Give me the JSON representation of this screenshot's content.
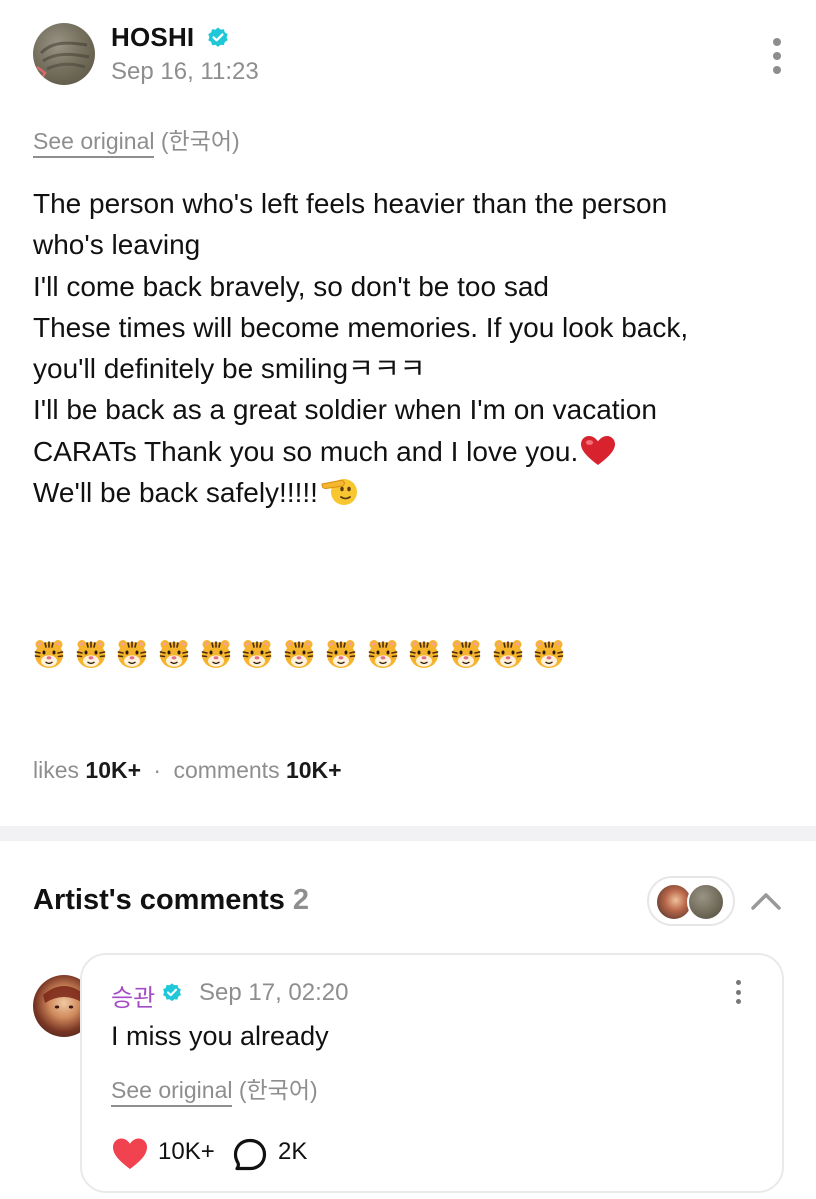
{
  "post": {
    "author": "HOSHI",
    "verified_icon": "verified-check-icon",
    "timestamp": "Sep 16, 11:23",
    "see_original_label": "See original",
    "original_language": "(한국어)",
    "body_lines": [
      "The person who's left feels heavier than the person",
      "who's leaving",
      "I'll come back bravely, so don't be too sad",
      "These times will become memories. If you look back,",
      "you'll definitely be smilingㅋㅋㅋ",
      "I'll be back as a great soldier when I'm on vacation",
      "CARATs Thank you so much and I love you.",
      "We'll be back safely!!!!!"
    ],
    "tiger_emoji_count": 13,
    "likes_label": "likes",
    "likes_value": "10K+",
    "separator": "·",
    "comments_label": "comments",
    "comments_value": "10K+"
  },
  "artist_comments": {
    "title": "Artist's comments",
    "count": "2",
    "comment": {
      "author": "승관",
      "timestamp": "Sep 17, 02:20",
      "text": "I miss you already",
      "see_original_label": "See original",
      "original_language": "(한국어)",
      "likes": "10K+",
      "replies": "2K"
    }
  },
  "colors": {
    "verified": "#1ec8d8",
    "comment_author": "#a34cc6",
    "heart": "#f0424f",
    "muted_text": "#8e8e8e"
  }
}
